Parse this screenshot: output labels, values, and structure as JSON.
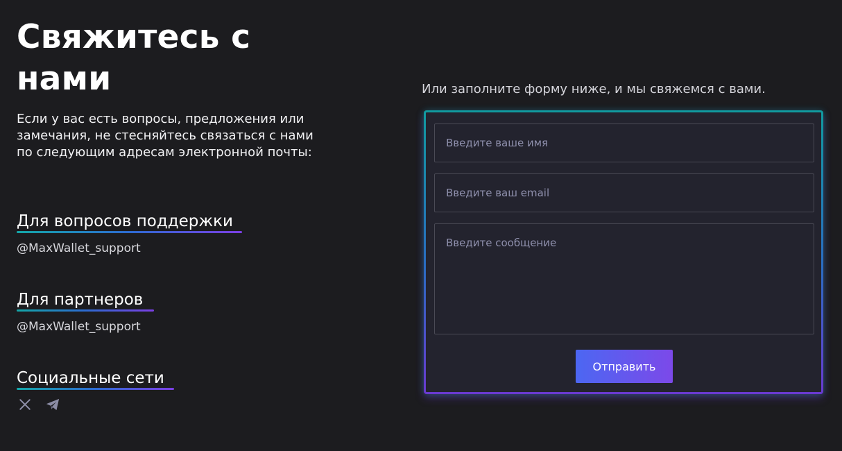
{
  "header": {
    "title": "Свяжитесь с нами",
    "intro": "Если у вас есть вопросы, предложения или замечания, не стесняйтесь связаться с нами по следующим адресам электронной почты:"
  },
  "contacts": {
    "support": {
      "heading": "Для вопросов поддержки",
      "handle": "@MaxWallet_support"
    },
    "partners": {
      "heading": "Для партнеров",
      "handle": "@MaxWallet_support"
    },
    "social": {
      "heading": "Социальные сети",
      "icons": [
        "x-icon",
        "telegram-icon"
      ]
    }
  },
  "form": {
    "caption": "Или заполните форму ниже, и мы свяжемся с вами.",
    "name_placeholder": "Введите ваше имя",
    "email_placeholder": "Введите ваш email",
    "message_placeholder": "Введите сообщение",
    "submit_label": "Отправить"
  },
  "colors": {
    "background": "#1c1c1f",
    "card": "#23232e",
    "accent_start": "#14a7a8",
    "accent_mid": "#2d6bd1",
    "accent_end": "#7b3fe4",
    "button_start": "#4c67f2",
    "button_end": "#7c49e9"
  }
}
